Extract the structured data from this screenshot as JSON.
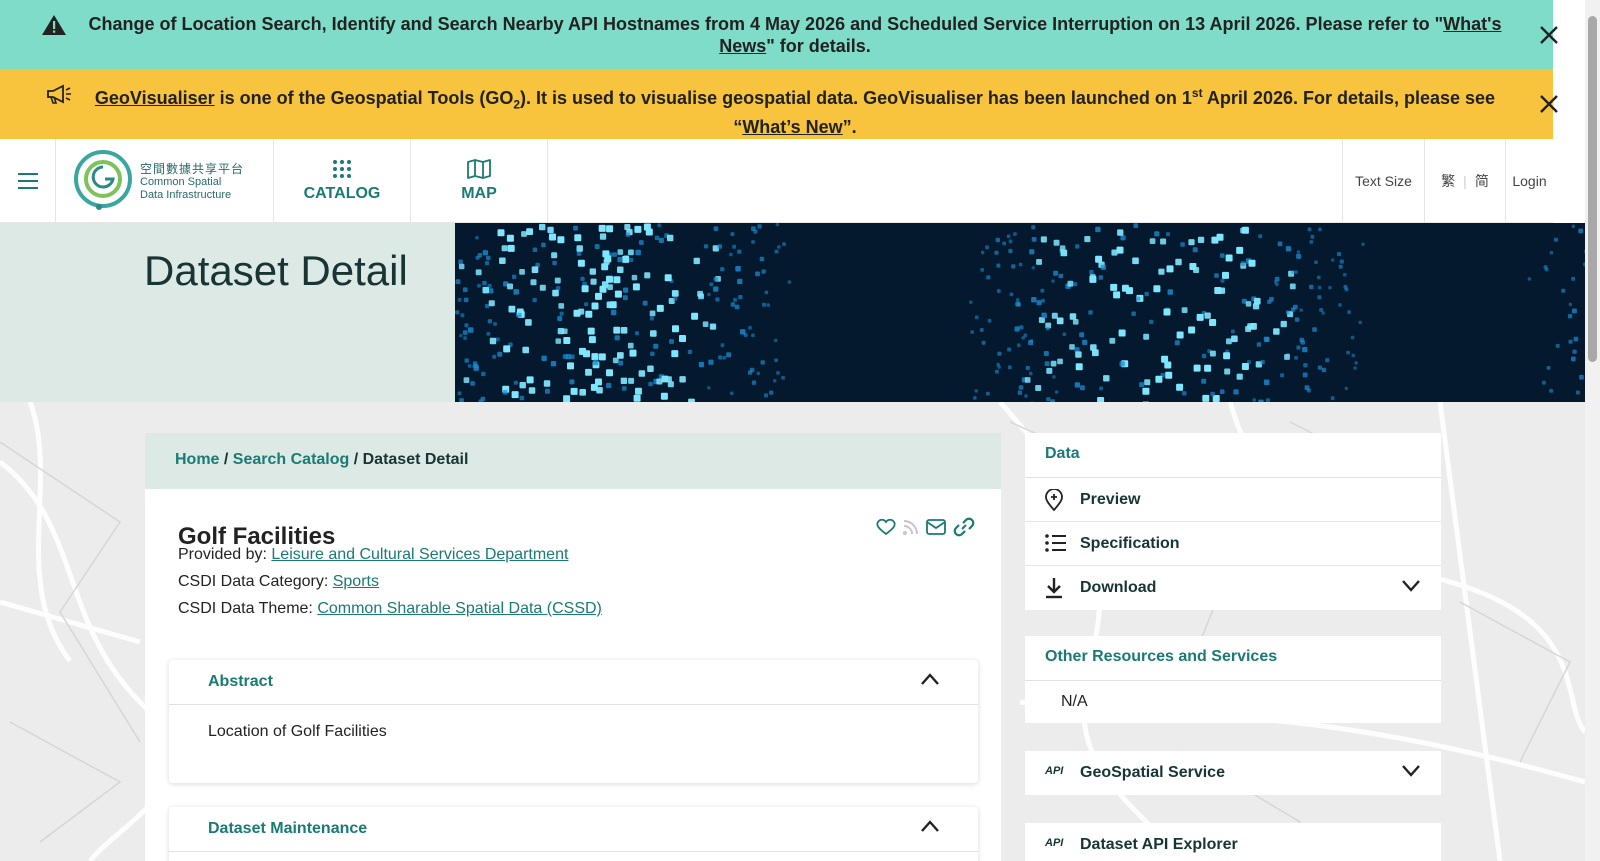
{
  "banners": {
    "notice": {
      "text_before": "Change of Location Search, Identify and Search Nearby API Hostnames from 4 May 2026 and Scheduled Service Interruption on 13 April 2026. Please refer to \"",
      "link": "What's News",
      "text_after": "\" for details."
    },
    "announcement": {
      "link1": "GeoVisualiser",
      "text1": " is one of the Geospatial Tools (GO",
      "sub": "2",
      "text2": "). It is used to visualise geospatial data. GeoVisualiser has been launched on 1",
      "sup": "st",
      "text3": " April 2026. For details, please see “",
      "link2": "What’s New",
      "text4": "”."
    }
  },
  "header": {
    "logo_cjk": "空間數據共享平台",
    "logo_line1": "Common Spatial",
    "logo_line2": "Data Infrastructure",
    "nav": [
      {
        "label": "CATALOG",
        "icon": "grid-dots-icon"
      },
      {
        "label": "MAP",
        "icon": "map-icon"
      }
    ],
    "text_size": "Text Size",
    "lang_trad": "繁",
    "lang_simp": "简",
    "login": "Login"
  },
  "hero": {
    "title": "Dataset Detail"
  },
  "breadcrumb": {
    "home": "Home",
    "sep1": " / ",
    "catalog": "Search Catalog",
    "sep2": " / ",
    "current": "Dataset Detail"
  },
  "dataset": {
    "title": "Golf Facilities",
    "provider_label": "Provided by: ",
    "provider": "Leisure and Cultural Services Department",
    "category_label": "CSDI Data Category: ",
    "category": "Sports",
    "theme_label": "CSDI Data Theme: ",
    "theme": "Common Sharable Spatial Data (CSSD)"
  },
  "sections": {
    "abstract_title": "Abstract",
    "abstract_body": "Location of Golf Facilities",
    "maintenance_title": "Dataset Maintenance"
  },
  "side": {
    "data_header": "Data",
    "preview": "Preview",
    "specification": "Specification",
    "download": "Download",
    "other_header": "Other Resources and Services",
    "other_value": "N/A",
    "geospatial": "GeoSpatial Service",
    "api_explorer": "Dataset API Explorer",
    "api_badge": "API"
  },
  "colors": {
    "teal_banner": "#7fdcc9",
    "yellow_banner": "#f8c33d",
    "accent": "#1a7a74",
    "hero_bg": "#dde9e5"
  }
}
